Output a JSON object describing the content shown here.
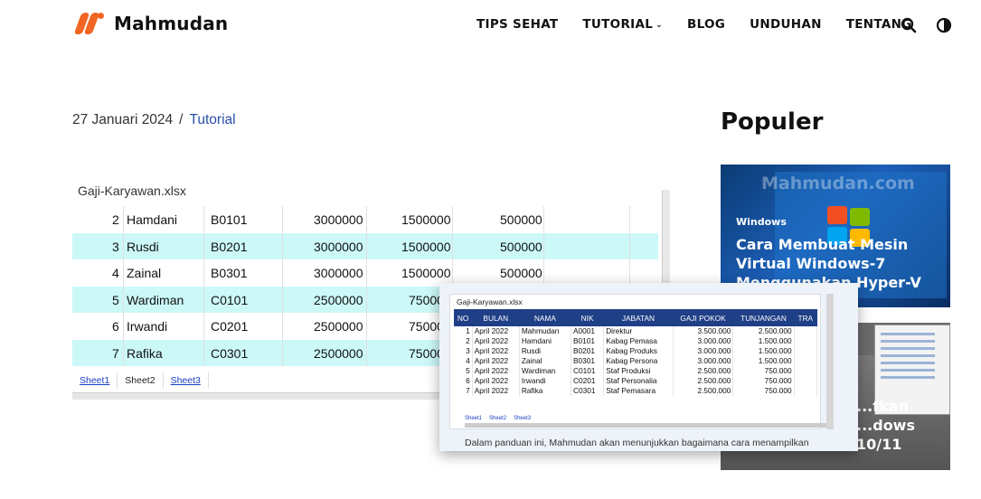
{
  "brand": {
    "name": "Mahmudan",
    "logo_sub": "Mahmudan",
    "accent": "#f26522"
  },
  "nav": {
    "items": [
      {
        "label": "TIPS SEHAT"
      },
      {
        "label": "TUTORIAL"
      },
      {
        "label": "BLOG"
      },
      {
        "label": "UNDUHAN"
      },
      {
        "label": "TENTANG"
      }
    ],
    "icons": [
      "search-icon",
      "contrast-toggle-icon"
    ]
  },
  "post": {
    "date": "27 Januari 2024",
    "separator": "/",
    "category": "Tutorial"
  },
  "sheet": {
    "filename": "Gaji-Karyawan.xlsx",
    "rows": [
      {
        "no": "2",
        "nama": "Hamdani",
        "nik": "B0101",
        "gaji": "3000000",
        "tunjangan": "1500000",
        "lain": "500000"
      },
      {
        "no": "3",
        "nama": "Rusdi",
        "nik": "B0201",
        "gaji": "3000000",
        "tunjangan": "1500000",
        "lain": "500000"
      },
      {
        "no": "4",
        "nama": "Zainal",
        "nik": "B0301",
        "gaji": "3000000",
        "tunjangan": "1500000",
        "lain": "500000"
      },
      {
        "no": "5",
        "nama": "Wardiman",
        "nik": "C0101",
        "gaji": "2500000",
        "tunjangan": "75000",
        "lain": ""
      },
      {
        "no": "6",
        "nama": "Irwandi",
        "nik": "C0201",
        "gaji": "2500000",
        "tunjangan": "75000",
        "lain": ""
      },
      {
        "no": "7",
        "nama": "Rafika",
        "nik": "C0301",
        "gaji": "2500000",
        "tunjangan": "75000",
        "lain": ""
      }
    ],
    "tabs": [
      "Sheet1",
      "Sheet2",
      "Sheet3"
    ]
  },
  "sidebar": {
    "title": "Populer",
    "cards": [
      {
        "watermark": "Mahmudan.com",
        "tag": "Windows",
        "title": "Cara Membuat Mesin Virtual Windows-7 Menggunakan Hyper-V"
      },
      {
        "title": "...fkan ...dows 10/11"
      }
    ]
  },
  "popup": {
    "filename": "Gaji-Karyawan.xlsx",
    "headers": [
      "NO",
      "BULAN",
      "NAMA",
      "NIK",
      "JABATAN",
      "GAJI POKOK",
      "TUNJANGAN",
      "TRA"
    ],
    "rows": [
      [
        "1",
        "April 2022",
        "Mahmudan",
        "A0001",
        "Direktur",
        "3.500.000",
        "2.500.000"
      ],
      [
        "2",
        "April 2022",
        "Hamdani",
        "B0101",
        "Kabag Pemasa",
        "3.000.000",
        "1.500.000"
      ],
      [
        "3",
        "April 2022",
        "Rusdi",
        "B0201",
        "Kabag Produks",
        "3.000.000",
        "1.500.000"
      ],
      [
        "4",
        "April 2022",
        "Zainal",
        "B0301",
        "Kabag Persona",
        "3.000.000",
        "1.500.000"
      ],
      [
        "5",
        "April 2022",
        "Wardiman",
        "C0101",
        "Staf Produksi",
        "2.500.000",
        "750.000"
      ],
      [
        "6",
        "April 2022",
        "Irwandi",
        "C0201",
        "Staf Personalia",
        "2.500.000",
        "750.000"
      ],
      [
        "7",
        "April 2022",
        "Rafika",
        "C0301",
        "Staf Pemasara",
        "2.500.000",
        "750.000"
      ]
    ],
    "tabs": [
      "Sheet1",
      "Sheet2",
      "Sheet3"
    ],
    "caption": "Dalam panduan ini, Mahmudan akan menunjukkan bagaimana cara menampilkan"
  }
}
